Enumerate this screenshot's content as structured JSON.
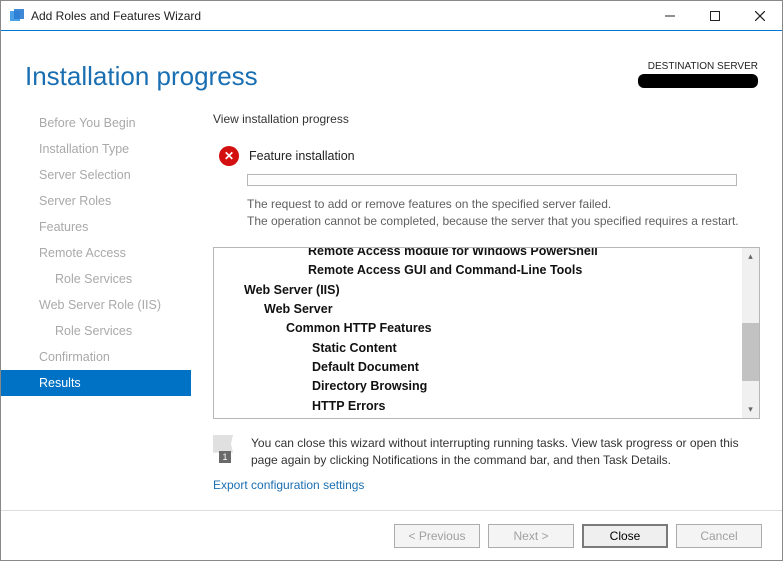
{
  "window": {
    "title": "Add Roles and Features Wizard"
  },
  "header": {
    "title": "Installation progress",
    "destination_label": "DESTINATION SERVER"
  },
  "nav": {
    "items": [
      {
        "label": "Before You Begin",
        "sub": false
      },
      {
        "label": "Installation Type",
        "sub": false
      },
      {
        "label": "Server Selection",
        "sub": false
      },
      {
        "label": "Server Roles",
        "sub": false
      },
      {
        "label": "Features",
        "sub": false
      },
      {
        "label": "Remote Access",
        "sub": false
      },
      {
        "label": "Role Services",
        "sub": true
      },
      {
        "label": "Web Server Role (IIS)",
        "sub": false
      },
      {
        "label": "Role Services",
        "sub": true
      },
      {
        "label": "Confirmation",
        "sub": false
      },
      {
        "label": "Results",
        "sub": false,
        "selected": true
      }
    ]
  },
  "main": {
    "view_label": "View installation progress",
    "status": "Feature installation",
    "msg_line1": "The request to add or remove features on the specified server failed.",
    "msg_line2": "The operation cannot be completed, because the server that you specified requires a restart.",
    "tree": {
      "cut1": "Remote Access module for Windows PowerShell",
      "cut2": "Remote Access GUI and Command-Line Tools",
      "l0": "Web Server (IIS)",
      "l1": "Web Server",
      "l2": "Common HTTP Features",
      "l3a": "Static Content",
      "l3b": "Default Document",
      "l3c": "Directory Browsing",
      "l3d": "HTTP Errors"
    },
    "hint": "You can close this wizard without interrupting running tasks. View task progress or open this page again by clicking Notifications in the command bar, and then Task Details.",
    "hint_badge": "1",
    "export": "Export configuration settings"
  },
  "footer": {
    "previous": "< Previous",
    "next": "Next >",
    "close": "Close",
    "cancel": "Cancel"
  }
}
